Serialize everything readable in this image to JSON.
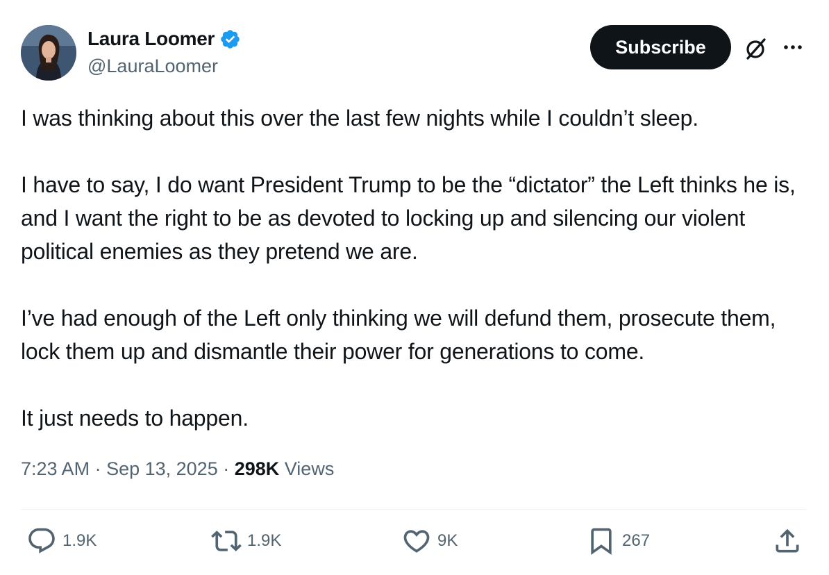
{
  "author": {
    "display_name": "Laura Loomer",
    "handle": "@LauraLoomer",
    "verified_icon": "verified-badge-icon",
    "verified_color": "#1d9bf0"
  },
  "header": {
    "subscribe_label": "Subscribe",
    "grok_icon": "grok-icon",
    "more_icon": "more-icon"
  },
  "tweet": {
    "paragraphs": [
      "I was thinking about this over the last few nights while I couldn’t sleep.",
      "I have to say, I do want President Trump to be the “dictator” the Left thinks he is, and I want the right to be as devoted to locking up and silencing our violent political enemies as they pretend we are.",
      "I’ve had enough of the Left only thinking we will defund them, prosecute them, lock them up and dismantle their power for generations to come.",
      "It just needs to happen."
    ]
  },
  "meta": {
    "time": "7:23 AM",
    "date": "Sep 13, 2025",
    "separator": " · ",
    "views_count": "298K",
    "views_label": "Views"
  },
  "actions": {
    "reply_count": "1.9K",
    "repost_count": "1.9K",
    "like_count": "9K",
    "bookmark_count": "267"
  },
  "colors": {
    "text_primary": "#0f1419",
    "text_secondary": "#536471",
    "button_bg": "#0f1419"
  }
}
